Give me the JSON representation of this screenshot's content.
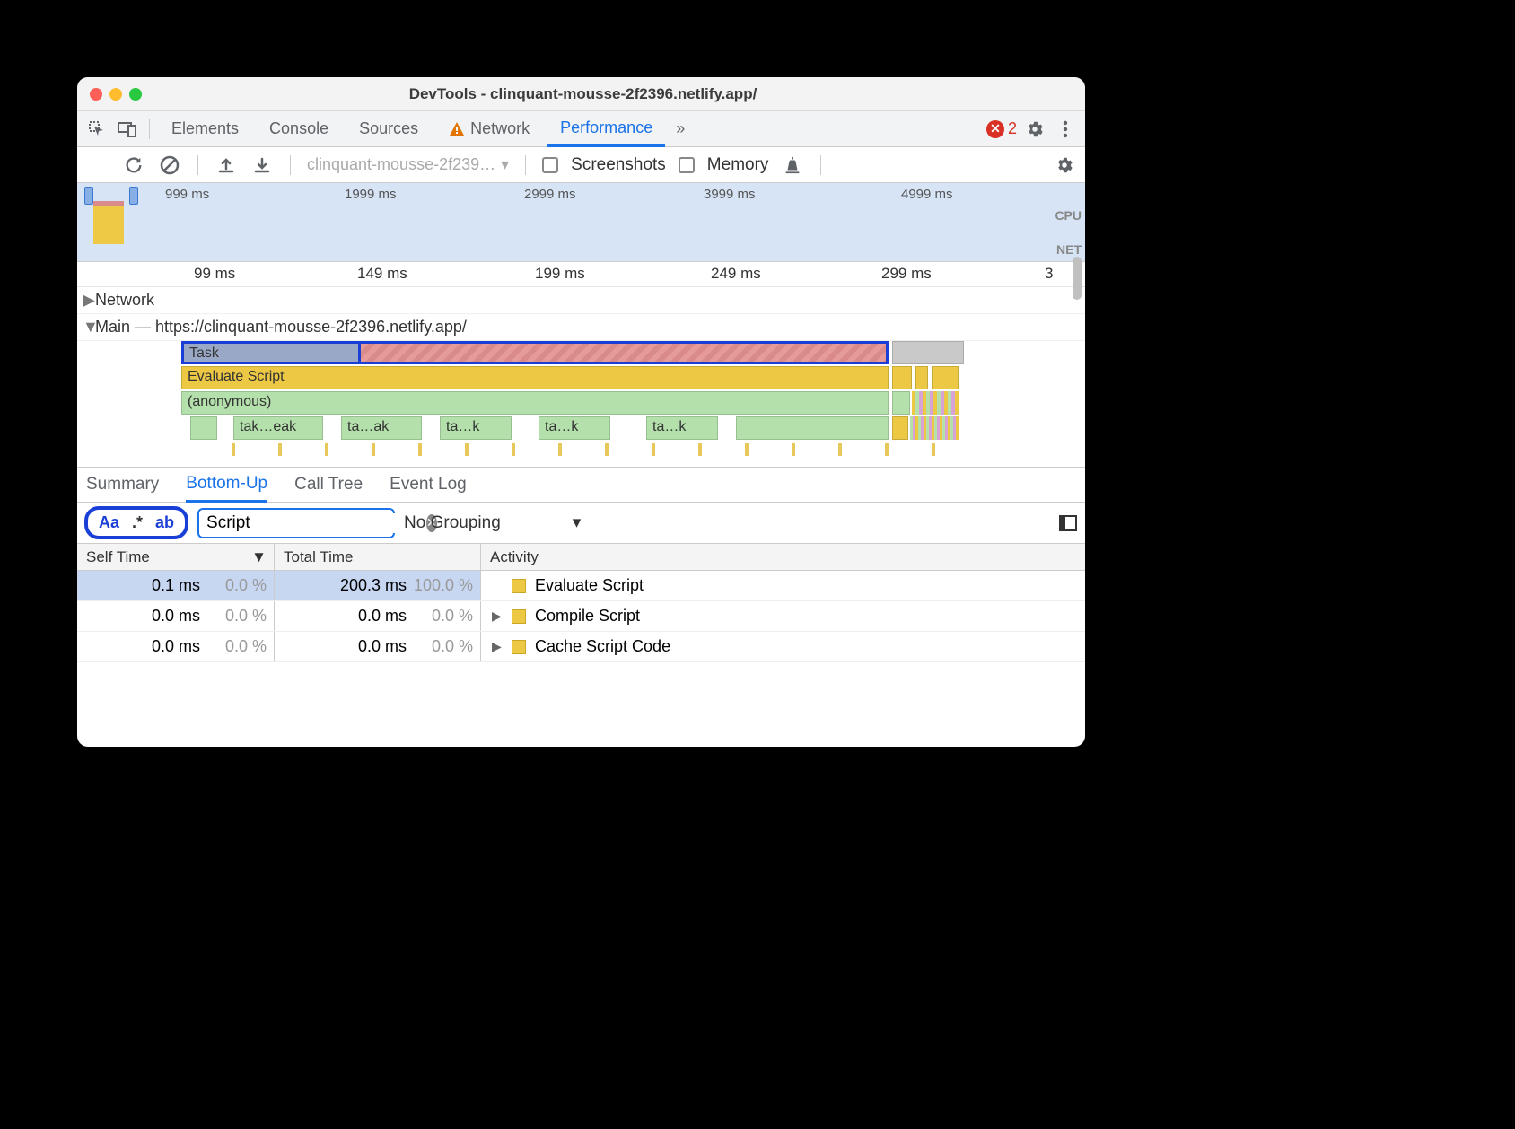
{
  "window": {
    "title": "DevTools - clinquant-mousse-2f2396.netlify.app/"
  },
  "main_tabs": {
    "elements": "Elements",
    "console": "Console",
    "sources": "Sources",
    "network": "Network",
    "performance": "Performance",
    "more": "»",
    "error_count": "2"
  },
  "toolbar": {
    "profile_label": "clinquant-mousse-2f239…",
    "screenshots_label": "Screenshots",
    "memory_label": "Memory"
  },
  "overview": {
    "ticks": [
      "999 ms",
      "1999 ms",
      "2999 ms",
      "3999 ms",
      "4999 ms"
    ],
    "lane_cpu": "CPU",
    "lane_net": "NET"
  },
  "ruler": {
    "ticks": [
      "99 ms",
      "149 ms",
      "199 ms",
      "249 ms",
      "299 ms",
      "3"
    ]
  },
  "tracks": {
    "network": "Network",
    "main": "Main — https://clinquant-mousse-2f2396.netlify.app/",
    "task": "Task",
    "eval": "Evaluate Script",
    "anon": "(anonymous)",
    "fn1": "tak…eak",
    "fn2": "ta…ak",
    "fn3": "ta…k",
    "fn4": "ta…k",
    "fn5": "ta…k"
  },
  "bottom_tabs": {
    "summary": "Summary",
    "bottom_up": "Bottom-Up",
    "call_tree": "Call Tree",
    "event_log": "Event Log"
  },
  "filter": {
    "match_case": "Aa",
    "regex": ".*",
    "whole_word": "ab",
    "value": "Script",
    "grouping": "No Grouping"
  },
  "table": {
    "headers": {
      "self": "Self Time",
      "total": "Total Time",
      "activity": "Activity"
    },
    "rows": [
      {
        "self_ms": "0.1 ms",
        "self_pct": "0.0 %",
        "total_ms": "200.3 ms",
        "total_pct": "100.0 %",
        "activity": "Evaluate Script",
        "expandable": false,
        "selected": true
      },
      {
        "self_ms": "0.0 ms",
        "self_pct": "0.0 %",
        "total_ms": "0.0 ms",
        "total_pct": "0.0 %",
        "activity": "Compile Script",
        "expandable": true,
        "selected": false
      },
      {
        "self_ms": "0.0 ms",
        "self_pct": "0.0 %",
        "total_ms": "0.0 ms",
        "total_pct": "0.0 %",
        "activity": "Cache Script Code",
        "expandable": true,
        "selected": false
      }
    ]
  }
}
